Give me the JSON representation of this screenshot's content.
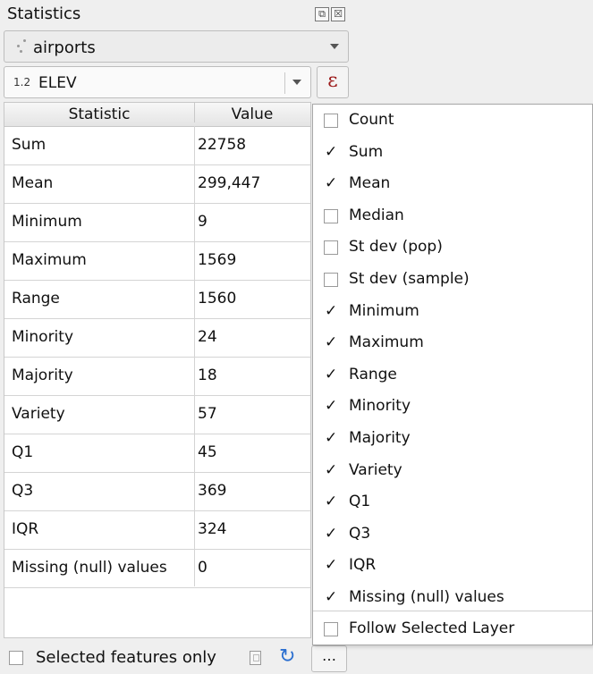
{
  "panel": {
    "title": "Statistics",
    "float_icon": "⧉",
    "close_icon": "☒"
  },
  "layer_combo": {
    "value": "airports",
    "icon": "point-layer-icon"
  },
  "field_combo": {
    "type_badge": "1.2",
    "value": "ELEV"
  },
  "expression_button": {
    "label": "ε"
  },
  "table": {
    "headers": [
      "Statistic",
      "Value"
    ],
    "rows": [
      [
        "Sum",
        "22758"
      ],
      [
        "Mean",
        "299,447"
      ],
      [
        "Minimum",
        "9"
      ],
      [
        "Maximum",
        "1569"
      ],
      [
        "Range",
        "1560"
      ],
      [
        "Minority",
        "24"
      ],
      [
        "Majority",
        "18"
      ],
      [
        "Variety",
        "57"
      ],
      [
        "Q1",
        "45"
      ],
      [
        "Q3",
        "369"
      ],
      [
        "IQR",
        "324"
      ],
      [
        "Missing (null) values",
        "0"
      ]
    ]
  },
  "bottom_bar": {
    "selected_only_label": "Selected features only",
    "selected_only_checked": false,
    "more_label": "…"
  },
  "menu": {
    "items": [
      {
        "label": "Count",
        "checked": false
      },
      {
        "label": "Sum",
        "checked": true
      },
      {
        "label": "Mean",
        "checked": true
      },
      {
        "label": "Median",
        "checked": false
      },
      {
        "label": "St dev (pop)",
        "checked": false
      },
      {
        "label": "St dev (sample)",
        "checked": false
      },
      {
        "label": "Minimum",
        "checked": true
      },
      {
        "label": "Maximum",
        "checked": true
      },
      {
        "label": "Range",
        "checked": true
      },
      {
        "label": "Minority",
        "checked": true
      },
      {
        "label": "Majority",
        "checked": true
      },
      {
        "label": "Variety",
        "checked": true
      },
      {
        "label": "Q1",
        "checked": true
      },
      {
        "label": "Q3",
        "checked": true
      },
      {
        "label": "IQR",
        "checked": true
      },
      {
        "label": "Missing (null) values",
        "checked": true
      }
    ],
    "follow_label": "Follow Selected Layer",
    "follow_checked": false
  },
  "colors": {
    "expression": "#9c1a1a",
    "refresh": "#2b6fd0"
  }
}
